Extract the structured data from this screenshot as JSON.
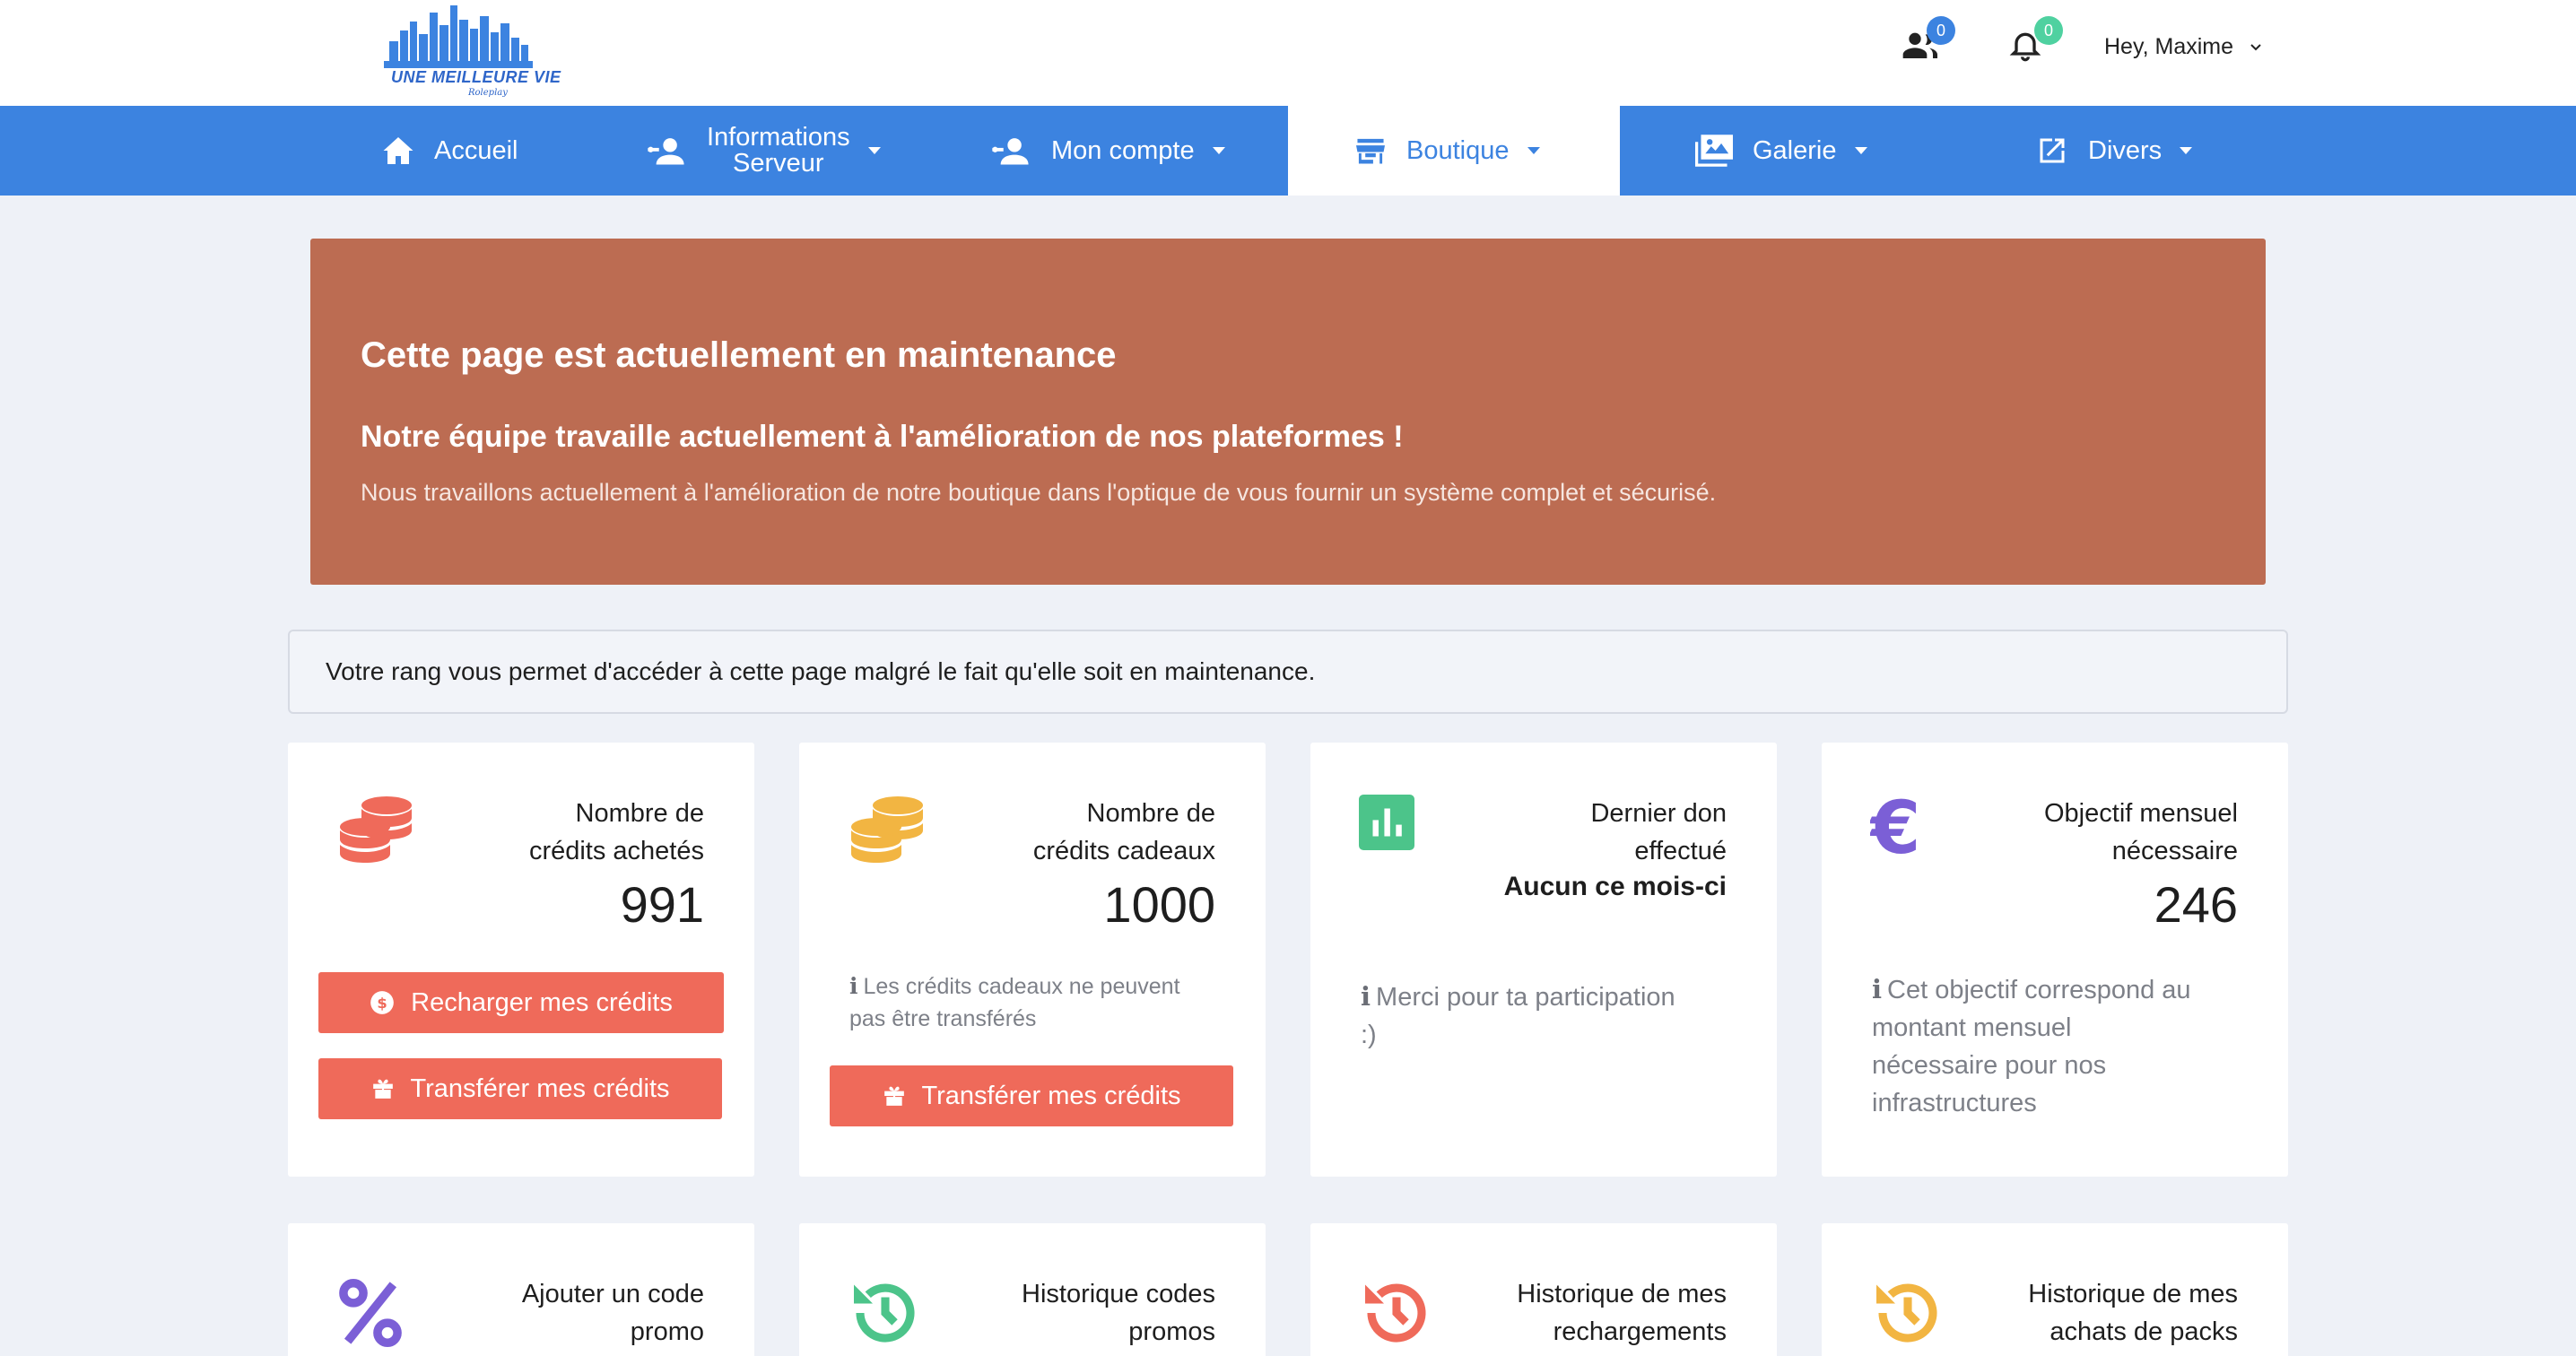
{
  "logo": {
    "brand": "UNE MEILLEURE VIE",
    "signature": "Roleplay"
  },
  "header": {
    "friends_badge": "0",
    "notifications_badge": "0",
    "user_greeting": "Hey, Maxime"
  },
  "nav": {
    "items": [
      {
        "label": "Accueil"
      },
      {
        "label_line1": "Informations",
        "label_line2": "Serveur"
      },
      {
        "label": "Mon compte"
      },
      {
        "label": "Boutique"
      },
      {
        "label": "Galerie"
      },
      {
        "label": "Divers"
      }
    ]
  },
  "banner": {
    "title": "Cette page est actuellement en maintenance",
    "subtitle": "Notre équipe travaille actuellement à l'amélioration de nos plateformes !",
    "text": "Nous travaillons actuellement à l'amélioration de notre boutique dans l'optique de vous fournir un système complet et sécurisé."
  },
  "notice": {
    "text": "Votre rang vous permet d'accéder à cette page malgré le fait qu'elle soit en maintenance."
  },
  "cards": [
    {
      "title_1": "Nombre de",
      "title_2": "crédits achetés",
      "value": "991",
      "btn1": "Recharger mes crédits",
      "btn2": "Transférer mes crédits"
    },
    {
      "title_1": "Nombre de",
      "title_2": "crédits cadeaux",
      "value": "1000",
      "note_1": "Les crédits cadeaux ne peuvent",
      "note_2": "pas être transférés",
      "btn1": "Transférer mes crédits"
    },
    {
      "title_1": "Dernier don",
      "title_2": "effectué",
      "subvalue": "Aucun ce mois-ci",
      "note_1": "Merci pour ta participation",
      "note_2": ":)"
    },
    {
      "title_1": "Objectif mensuel",
      "title_2": "nécessaire",
      "value": "246",
      "note_1": "Cet objectif correspond au",
      "note_2": "montant mensuel",
      "note_3": "nécessaire pour nos",
      "note_4": "infrastructures"
    }
  ],
  "cards_row2": [
    {
      "title_1": "Ajouter un code",
      "title_2": "promo"
    },
    {
      "title_1": "Historique codes",
      "title_2": "promos"
    },
    {
      "title_1": "Historique de mes",
      "title_2": "rechargements"
    },
    {
      "title_1": "Historique de mes",
      "title_2": "achats de packs"
    }
  ],
  "colors": {
    "nav_bg": "#3c83e0",
    "banner_bg": "#bc6c52",
    "button_bg": "#ef6a5a",
    "badge_blue": "#3c83e0",
    "badge_green": "#4fd1a0"
  }
}
